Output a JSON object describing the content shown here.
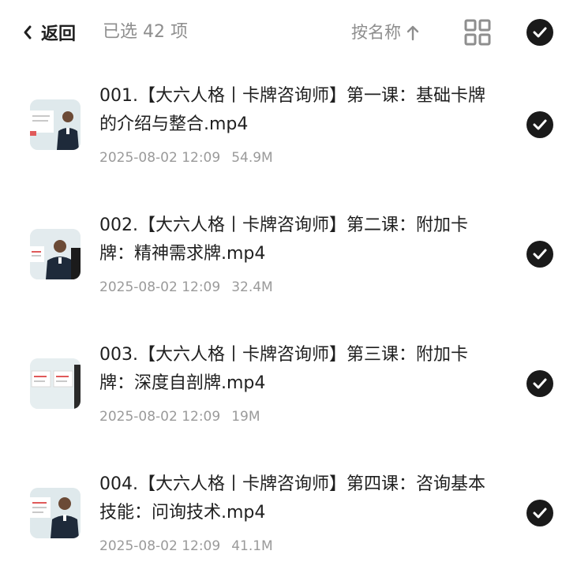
{
  "header": {
    "back_label": "返回",
    "selected_count": "已选 42 项",
    "sort_label": "按名称",
    "sort_icon": "arrow-up-icon",
    "view_toggle_icon": "grid-view-icon",
    "select_all_icon": "check-circle-icon"
  },
  "colors": {
    "accent": "#1a1a1a",
    "muted": "#8e8e8e"
  },
  "files": [
    {
      "name": "001.【大六人格丨卡牌咨询师】第一课：基础卡牌的介绍与整合.mp4",
      "date": "2025-08-02 12:09",
      "size": "54.9M",
      "selected": true
    },
    {
      "name": "002.【大六人格丨卡牌咨询师】第二课：附加卡牌：精神需求牌.mp4",
      "date": "2025-08-02 12:09",
      "size": "32.4M",
      "selected": true
    },
    {
      "name": "003.【大六人格丨卡牌咨询师】第三课：附加卡牌：深度自剖牌.mp4",
      "date": "2025-08-02 12:09",
      "size": "19M",
      "selected": true
    },
    {
      "name": "004.【大六人格丨卡牌咨询师】第四课：咨询基本技能：问询技术.mp4",
      "date": "2025-08-02 12:09",
      "size": "41.1M",
      "selected": true
    }
  ]
}
